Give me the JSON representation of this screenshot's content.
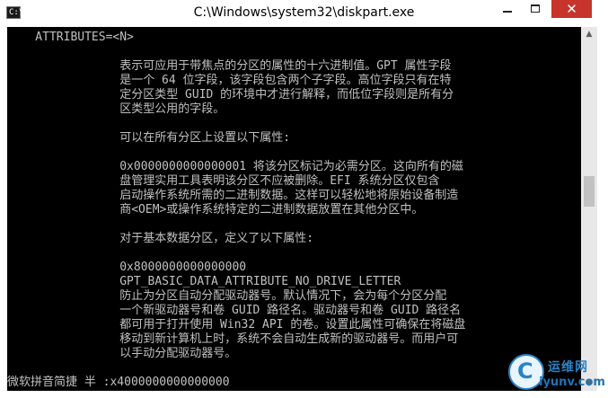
{
  "window": {
    "title": "C:\\Windows\\system32\\diskpart.exe",
    "icon_label": "C:\\",
    "controls": {
      "minimize": "minimize-icon",
      "maximize": "maximize-icon",
      "close": "✕"
    }
  },
  "console": {
    "lines": [
      "    ATTRIBUTES=<N>",
      "",
      "                表示可应用于带焦点的分区的属性的十六进制值。GPT 属性字段",
      "                是一个 64 位字段，该字段包含两个子字段。高位字段只有在特",
      "                定分区类型 GUID 的环境中才进行解释，而低位字段则是所有分",
      "                区类型公用的字段。",
      "",
      "                可以在所有分区上设置以下属性:",
      "",
      "                0x0000000000000001 将该分区标记为必需分区。这向所有的磁",
      "                盘管理实用工具表明该分区不应被删除。EFI 系统分区仅包含",
      "                启动操作系统所需的二进制数据。这样可以轻松地将原始设备制造",
      "                商<OEM>或操作系统特定的二进制数据放置在其他分区中。",
      "",
      "                对于基本数据分区，定义了以下属性:",
      "",
      "                0x8000000000000000",
      "                GPT_BASIC_DATA_ATTRIBUTE_NO_DRIVE_LETTER",
      "                防止为分区自动分配驱动器号。默认情况下，会为每个分区分配",
      "                一个新驱动器号和卷 GUID 路径名。驱动器号和卷 GUID 路径名",
      "                都可用于打开使用 Win32 API 的卷。设置此属性可确保在将磁盘",
      "                移动到新计算机上时，系统不会自动生成新的驱动器号。而用户可",
      "                以手动分配驱动器号。",
      "",
      "微软拼音简捷 半 :x4000000000000000"
    ],
    "colors": {
      "background": "#000000",
      "text": "#c0c0c0"
    }
  },
  "scrollbar": {
    "up_arrow": "▲",
    "down_arrow": "▼"
  },
  "watermark": {
    "brand": "运维网",
    "domain": "iyunv.com",
    "logo_letter": "C",
    "accent": "#2b83c5"
  }
}
